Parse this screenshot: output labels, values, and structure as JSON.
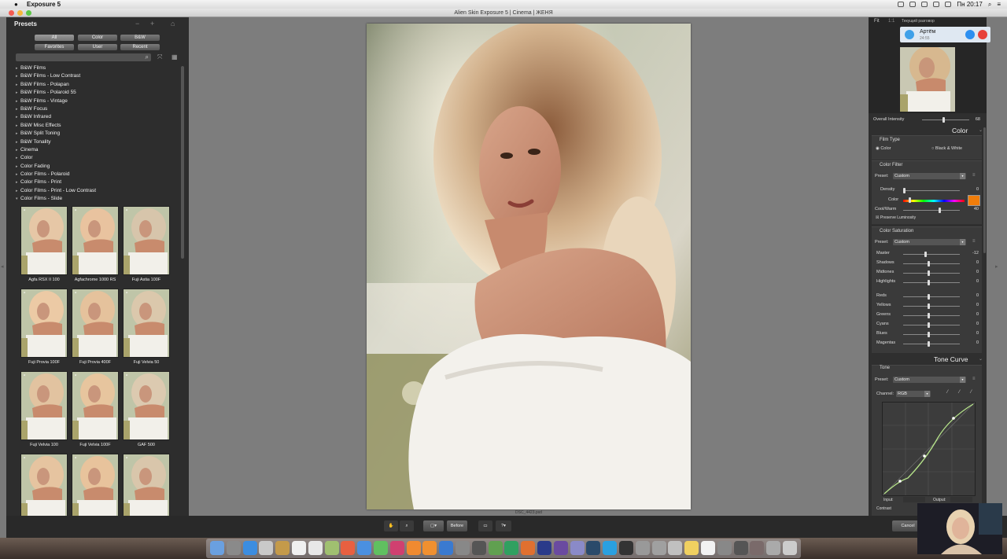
{
  "menubar": {
    "app": "Exposure 5",
    "clock": "Пн 20:17"
  },
  "window": {
    "title": "Alien Skin Exposure 5 | Cinema | ЖЕНЯ"
  },
  "presets": {
    "title": "Presets",
    "tabs_row1": [
      "All",
      "Color",
      "B&W"
    ],
    "tabs_row2": [
      "Favorites",
      "User",
      "Recent"
    ],
    "tree": [
      "B&W Films",
      "B&W Films - Low Contrast",
      "B&W Films - Polapan",
      "B&W Films - Polaroid 55",
      "B&W Films - Vintage",
      "B&W Focus",
      "B&W Infrared",
      "B&W Misc Effects",
      "B&W Split Toning",
      "B&W Tonality",
      "Cinema",
      "Color",
      "Color Fading",
      "Color Films - Polaroid",
      "Color Films - Print",
      "Color Films - Print - Low Contrast",
      "Color Films - Slide"
    ],
    "thumbs": [
      "Agfa RSX II 100",
      "Agfachrome 1000 RS",
      "Fuji Astia 100F",
      "Fuji Provia 100F",
      "Fuji Provia 400F",
      "Fuji Velvia 50",
      "Fuji Velvia 100",
      "Fuji Velvia 100F",
      "GAF 500",
      "",
      "",
      ""
    ]
  },
  "canvas": {
    "filename": "DSC_4423.psd"
  },
  "right": {
    "fit": "Fit",
    "one_to_one": "1:1",
    "call_header": "Текущий разговор",
    "caller": "Артём",
    "call_time": "24:55",
    "overall_intensity_label": "Overall Intensity",
    "overall_intensity": "68",
    "color_section": "Color",
    "film_type": "Film Type",
    "film_color": "Color",
    "film_bw": "Black & White",
    "color_filter": "Color Filter",
    "preset_label": "Preset:",
    "preset_value": "Custom",
    "density_label": "Density",
    "density": "0",
    "color_label": "Color",
    "coolwarm_label": "Cool/Warm",
    "coolwarm": "40",
    "preserve": "Preserve Luminosity",
    "color_saturation": "Color Saturation",
    "sat_rows": [
      {
        "label": "Master",
        "value": "-12"
      },
      {
        "label": "Shadows",
        "value": "0"
      },
      {
        "label": "Midtones",
        "value": "0"
      },
      {
        "label": "Highlights",
        "value": "0"
      },
      {
        "label": "Reds",
        "value": "0"
      },
      {
        "label": "Yellows",
        "value": "0"
      },
      {
        "label": "Greens",
        "value": "0"
      },
      {
        "label": "Cyans",
        "value": "0"
      },
      {
        "label": "Blues",
        "value": "0"
      },
      {
        "label": "Magentas",
        "value": "0"
      }
    ],
    "tone_curve": "Tone Curve",
    "tone": "Tone",
    "channel_label": "Channel:",
    "channel_value": "RGB",
    "input_label": "Input:",
    "output_label": "Output:",
    "contrast_label": "Contrast"
  },
  "bottombar": {
    "before": "Before",
    "cancel": "Cancel"
  },
  "colors": {
    "accent_swatch": "#f07d0a",
    "panel": "#2d2d2d",
    "canvas": "#7d7d7d"
  }
}
